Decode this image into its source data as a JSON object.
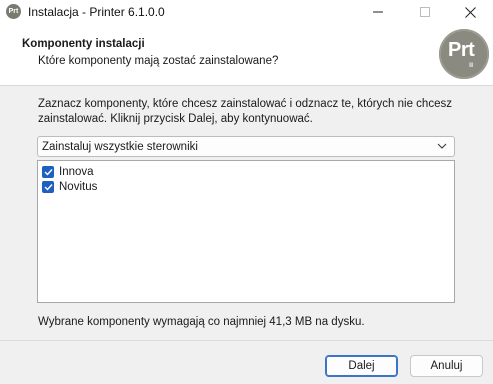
{
  "window": {
    "title": "Instalacja - Printer 6.1.0.0",
    "icon_label": "Prt"
  },
  "header": {
    "title": "Komponenty instalacji",
    "subtitle": "Które komponenty mają zostać zainstalowane?",
    "logo_text": "Prt",
    "logo_sub": "Ⅲ"
  },
  "main": {
    "instructions": "Zaznacz komponenty, które chcesz zainstalować i odznacz te, których nie chcesz zainstalować. Kliknij przycisk Dalej, aby kontynuować.",
    "install_type": "Zainstaluj wszystkie sterowniki",
    "components": [
      {
        "label": "Innova",
        "checked": true
      },
      {
        "label": "Novitus",
        "checked": true
      }
    ],
    "space_note": "Wybrane komponenty wymagają co najmniej 41,3 MB na dysku."
  },
  "footer": {
    "next_label": "Dalej",
    "cancel_label": "Anuluj"
  },
  "colors": {
    "accent": "#1f5fbf",
    "title_bar": "#ffffff",
    "body_bg": "#f0f0f0"
  }
}
